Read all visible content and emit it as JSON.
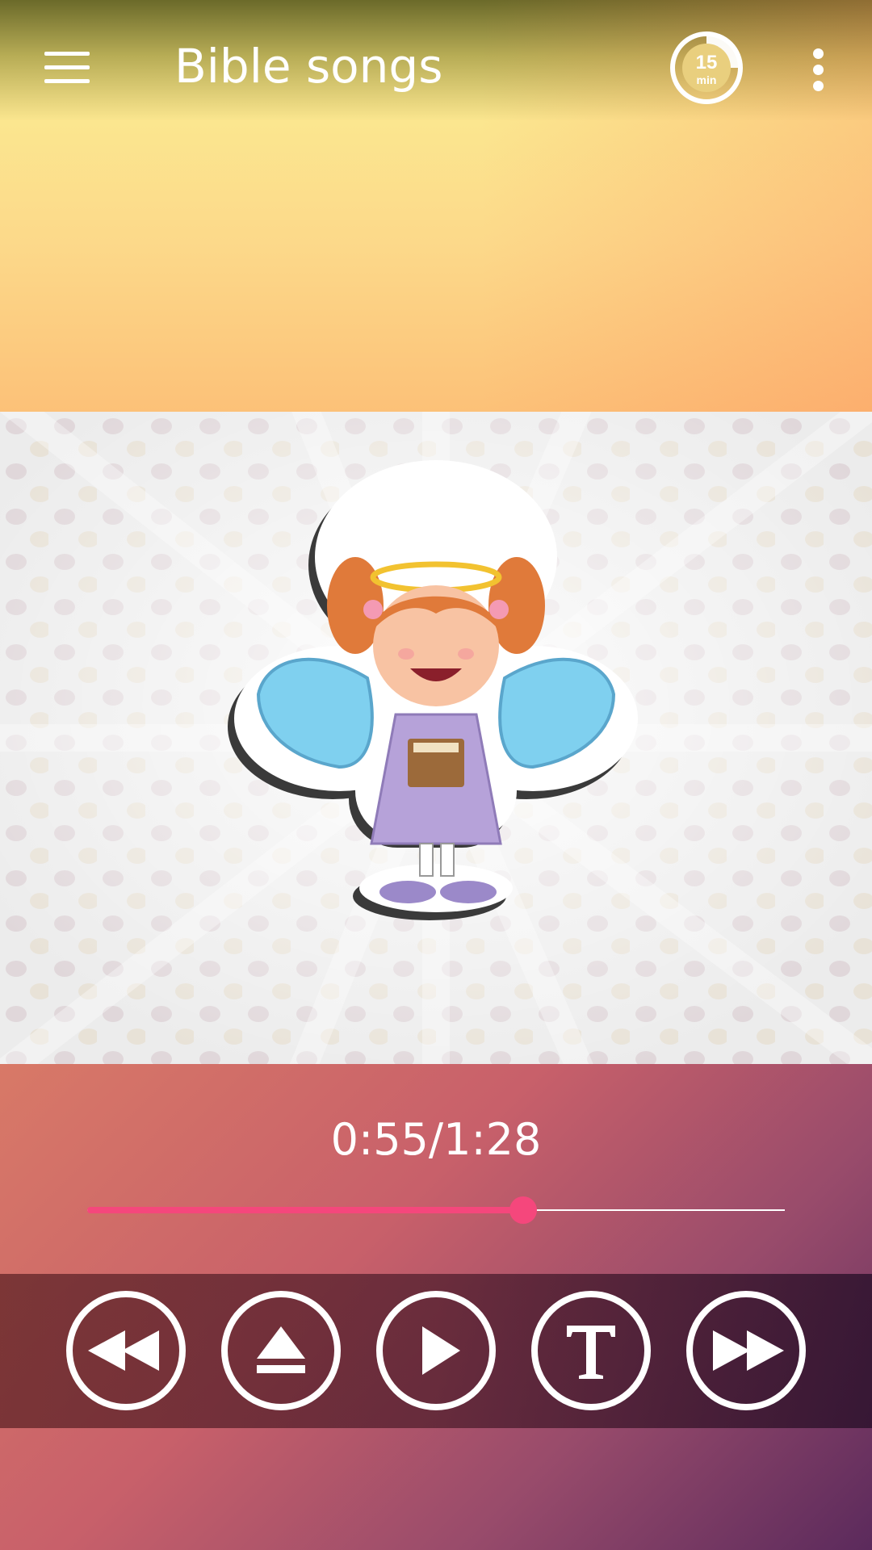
{
  "app": {
    "title": "Bible songs",
    "timer_value": "15",
    "timer_unit": "min"
  },
  "player": {
    "time": "0:55/1:28",
    "progress": 0.625
  },
  "colors": {
    "accent": "#f5477c",
    "controls_bar": "#5a2330"
  },
  "icons": [
    "menu-icon",
    "sleep-timer-icon",
    "more-vert-icon",
    "rewind-icon",
    "eject-icon",
    "play-icon",
    "lyrics-text-icon",
    "fast-forward-icon"
  ]
}
